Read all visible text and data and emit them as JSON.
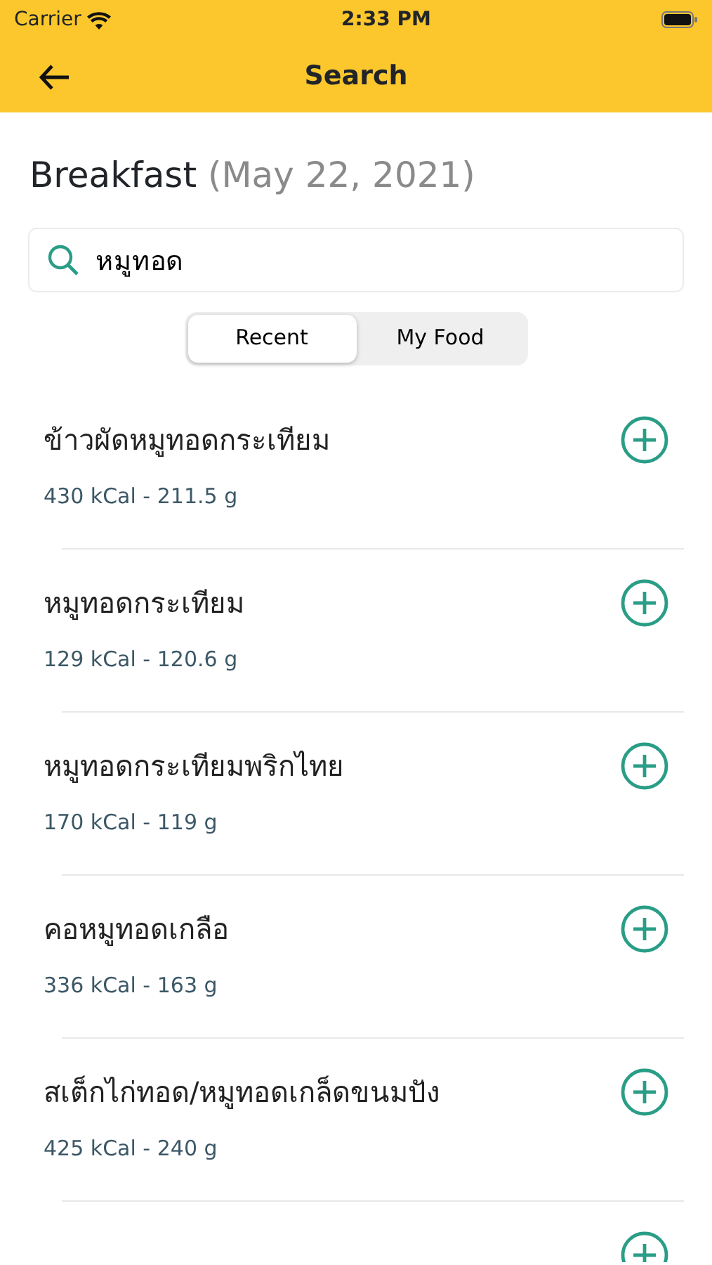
{
  "status_bar": {
    "carrier": "Carrier",
    "time": "2:33 PM"
  },
  "nav": {
    "title": "Search"
  },
  "meal": {
    "name": "Breakfast",
    "date": "(May 22, 2021)"
  },
  "search": {
    "value": "หมูทอด"
  },
  "tabs": [
    {
      "label": "Recent",
      "selected": true
    },
    {
      "label": "My Food",
      "selected": false
    }
  ],
  "foods": [
    {
      "kind": "item",
      "name": "ข้าวผัดหมูทอดกระเทียม",
      "detail": "430 kCal - 211.5 g"
    },
    {
      "kind": "item",
      "name": "หมูทอดกระเทียม",
      "detail": "129 kCal - 120.6 g"
    },
    {
      "kind": "item",
      "name": "หมูทอดกระเทียมพริกไทย",
      "detail": "170 kCal - 119 g"
    },
    {
      "kind": "item",
      "name": "คอหมูทอดเกลือ",
      "detail": "336 kCal - 163 g"
    },
    {
      "kind": "item",
      "name": "สเต็กไก่ทอด/หมูทอดเกล็ดขนมปัง",
      "detail": "425 kCal - 240 g"
    },
    {
      "kind": "cut"
    }
  ]
}
